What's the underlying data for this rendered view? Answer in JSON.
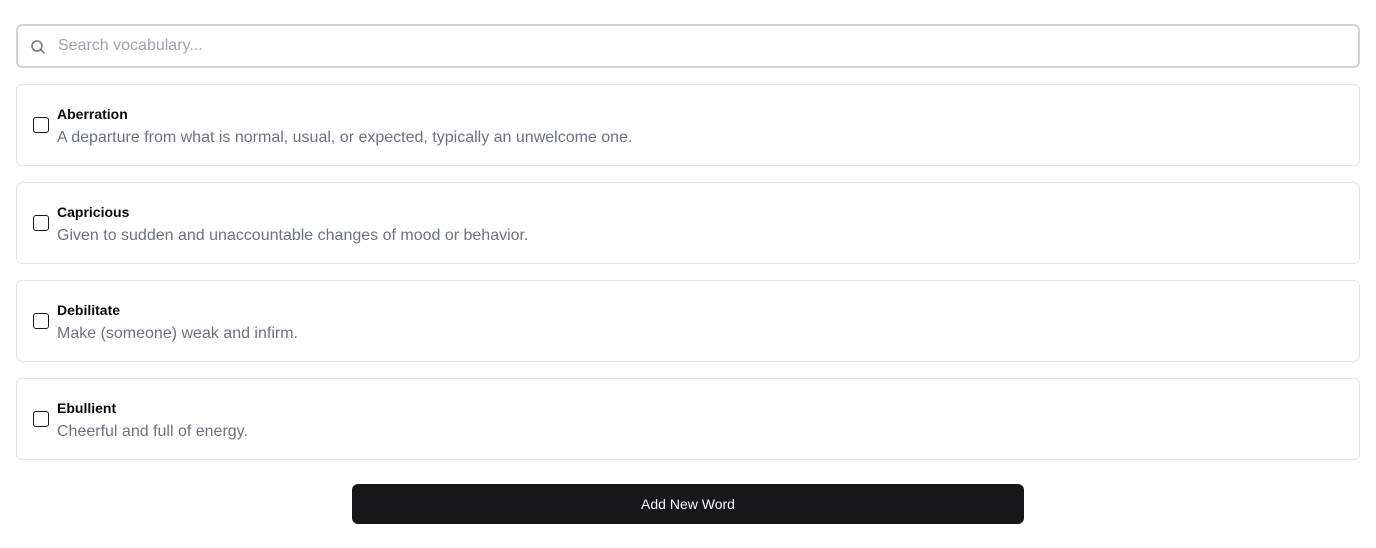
{
  "search": {
    "placeholder": "Search vocabulary...",
    "value": ""
  },
  "words": [
    {
      "term": "Aberration",
      "definition": "A departure from what is normal, usual, or expected, typically an unwelcome one.",
      "checked": false
    },
    {
      "term": "Capricious",
      "definition": "Given to sudden and unaccountable changes of mood or behavior.",
      "checked": false
    },
    {
      "term": "Debilitate",
      "definition": "Make (someone) weak and infirm.",
      "checked": false
    },
    {
      "term": "Ebullient",
      "definition": "Cheerful and full of energy.",
      "checked": false
    }
  ],
  "actions": {
    "add_label": "Add New Word"
  },
  "icons": {
    "search": "search-icon"
  },
  "colors": {
    "button_bg": "#18181b",
    "button_text": "#fafafa",
    "definition_text": "#6b7280",
    "border": "#e4e4e7"
  }
}
